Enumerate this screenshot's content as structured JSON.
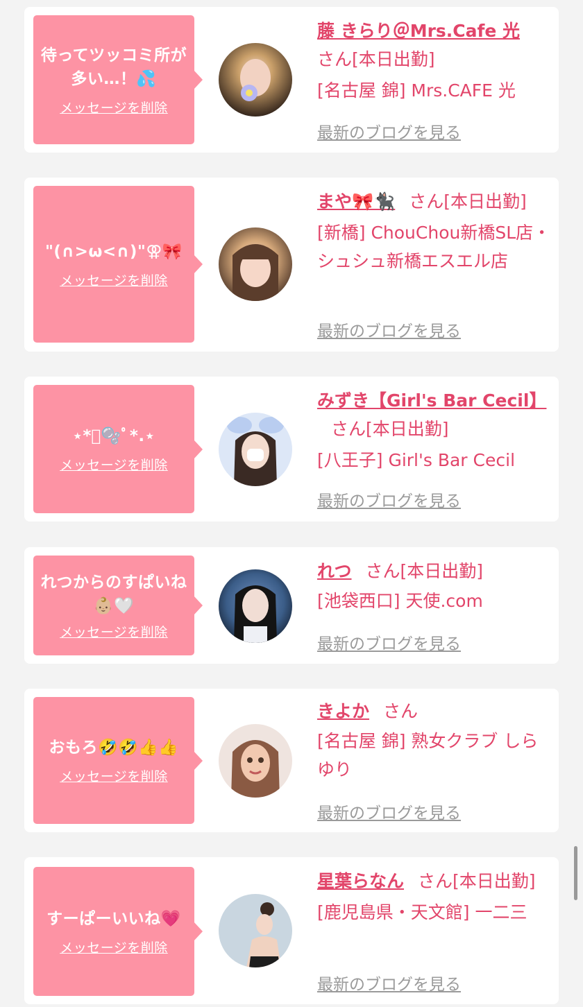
{
  "common": {
    "delete_label": "メッセージを削除",
    "blog_label": "最新のブログを見る"
  },
  "items": [
    {
      "message": "待ってツッコミ所が多い…！💦",
      "name": "藤 きらり＠Mrs.Cafe 光",
      "suffix": "さん[本日出勤]",
      "shop": "[名古屋 錦] Mrs.CAFE 光",
      "avatar_icon": "avatar-photo",
      "avatar_colors": [
        "#caa06a",
        "#2a1d16"
      ]
    },
    {
      "message": "\"(∩>ω<∩)\"⚢🎀",
      "name": "まや🎀🐈‍⬛",
      "suffix": "さん[本日出勤]",
      "shop": "[新橋] ChouChou新橋SL店・シュシュ新橋エスエル店",
      "avatar_icon": "avatar-photo",
      "avatar_colors": [
        "#d6a97b",
        "#4a3326"
      ]
    },
    {
      "message": "⋆*ﾟ🫧ﾟ*.⋆",
      "name": "みずき【Girl's Bar Cecil】",
      "suffix": "さん[本日出勤]",
      "shop": "[八王子] Girl's Bar Cecil",
      "avatar_icon": "avatar-photo",
      "avatar_colors": [
        "#dde7f7",
        "#3a2a24"
      ]
    },
    {
      "message": "れつからのすぱいね👶🏼🤍",
      "name": "れつ",
      "suffix": "さん[本日出勤]",
      "shop": "[池袋西口] 天使.com",
      "avatar_icon": "avatar-photo",
      "avatar_colors": [
        "#3b5d88",
        "#101826"
      ]
    },
    {
      "message": "おもろ🤣🤣👍👍",
      "name": "きよか",
      "suffix": "さん",
      "shop": "[名古屋 錦] 熟女クラブ しらゆり",
      "avatar_icon": "avatar-photo",
      "avatar_colors": [
        "#efe4df",
        "#8a5a43"
      ]
    },
    {
      "message": "すーぱーいいね💗",
      "name": "星葉らなん",
      "suffix": "さん[本日出勤]",
      "shop": "[鹿児島県・天文館] 一二三",
      "avatar_icon": "avatar-photo",
      "avatar_colors": [
        "#c9d6e0",
        "#1d1d1d"
      ]
    }
  ]
}
